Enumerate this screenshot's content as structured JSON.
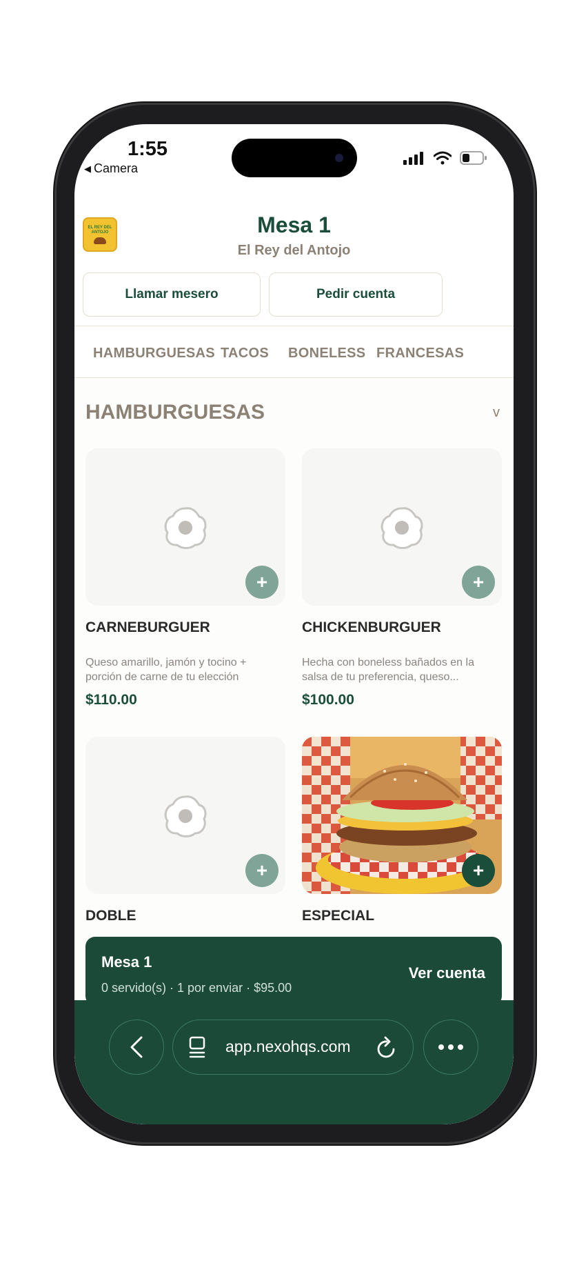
{
  "status": {
    "time": "1:55",
    "back_label": "Camera"
  },
  "header": {
    "logo_text": "EL REY DEL ANTOJO",
    "title": "Mesa 1",
    "subtitle": "El Rey del Antojo"
  },
  "actions": {
    "call_waiter": "Llamar mesero",
    "request_bill": "Pedir cuenta"
  },
  "tabs": [
    "HAMBURGUESAS",
    "TACOS",
    "BONELESS",
    "FRANCESAS"
  ],
  "section": {
    "title": "HAMBURGUESAS",
    "toggle": "v"
  },
  "products": [
    {
      "name": "CARNEBURGUER",
      "description": "Queso amarillo, jamón y tocino + porción de carne de tu elección",
      "price": "$110.00",
      "add_label": "+"
    },
    {
      "name": "CHICKENBURGUER",
      "description": "Hecha con boneless bañados en la salsa de tu preferencia, queso...",
      "price": "$100.00",
      "add_label": "+"
    },
    {
      "name": "DOBLE",
      "add_label": "+"
    },
    {
      "name": "ESPECIAL",
      "add_label": "+"
    }
  ],
  "order_bar": {
    "title": "Mesa 1",
    "summary": "0 servido(s) · 1 por enviar · $95.00",
    "action": "Ver cuenta"
  },
  "browser": {
    "url": "app.nexohqs.com"
  },
  "colors": {
    "brand_green": "#1a4d3a",
    "muted_text": "#8b8175",
    "add_button": "#80a498"
  }
}
